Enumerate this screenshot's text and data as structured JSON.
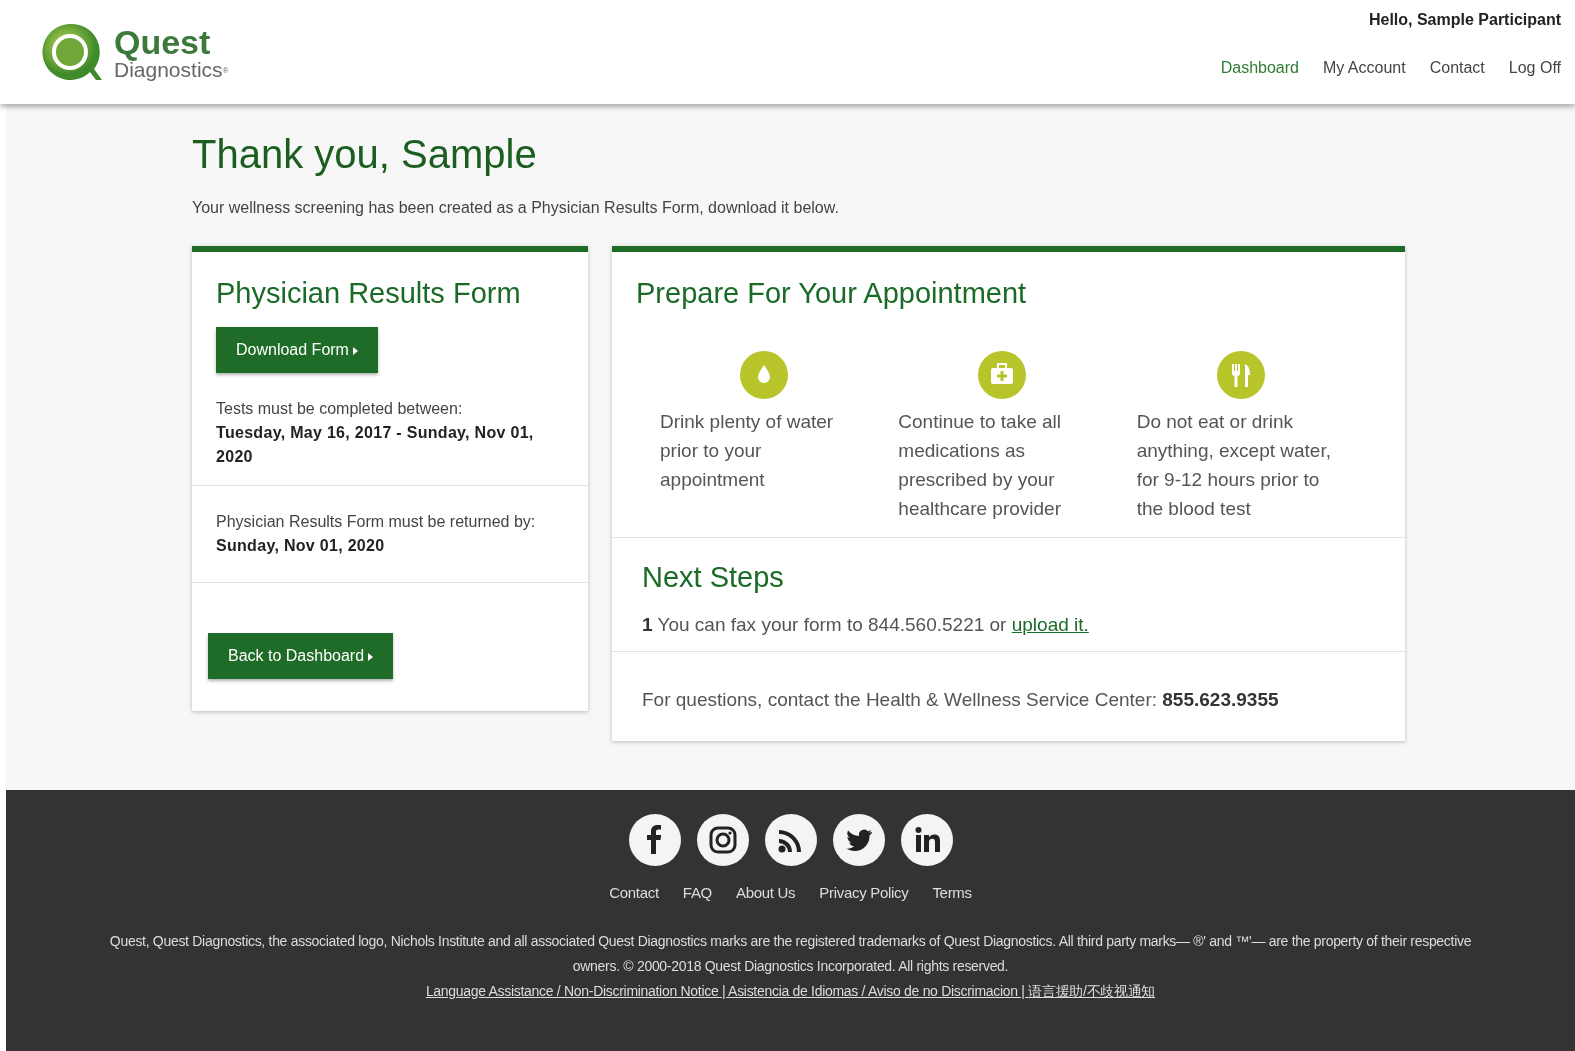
{
  "header": {
    "logo": {
      "line_1": "Quest",
      "line_2": "Diagnostics",
      "mark": "®"
    },
    "greeting": "Hello, Sample Participant",
    "nav": [
      {
        "label": "Dashboard",
        "selected": true
      },
      {
        "label": "My Account",
        "selected": false
      },
      {
        "label": "Contact",
        "selected": false
      },
      {
        "label": "Log Off",
        "selected": false
      }
    ]
  },
  "page": {
    "title": "Thank you, Sample",
    "intro": "Your wellness screening has been created as a Physician Results Form, download it below."
  },
  "form_card": {
    "title": "Physician Results Form",
    "download_button": "Download Form",
    "tests_label": "Tests must be completed between:",
    "tests_dates": "Tuesday, May 16, 2017 - Sunday, Nov 01, 2020",
    "return_label": "Physician Results Form must be returned by:",
    "return_date": "Sunday, Nov 01, 2020",
    "back_button": "Back to Dashboard"
  },
  "prepare_card": {
    "title": "Prepare For Your Appointment",
    "tips": [
      {
        "text": "Drink plenty of water prior to your appointment"
      },
      {
        "text": "Continue to take all medications as prescribed by your healthcare provider"
      },
      {
        "text": "Do not eat or drink anything, except water, for 9-12 hours prior to the blood test"
      }
    ],
    "next_steps_title": "Next Steps",
    "steps": [
      {
        "number": "1",
        "text": "You can fax your form to 844.560.5221 or",
        "link": "upload it."
      }
    ],
    "questions": "For questions, contact the Health & Wellness Service Center: **855.623.9355**"
  },
  "footer": {
    "links": [
      "Contact",
      "FAQ",
      "About Us",
      "Privacy Policy",
      "Terms"
    ],
    "legal": "Quest, Quest Diagnostics, the associated logo, Nichols Institute and all associated Quest Diagnostics marks are the registered trademarks of Quest Diagnostics. All third party marks— ®' and ™'— are the property of their respective owners. © 2000-2018 Quest Diagnostics Incorporated. All rights reserved.",
    "language_link": "Language Assistance / Non-Discrimination Notice | Asistencia de Idiomas / Aviso de no Discrimacion | 语言援助/不歧视通知"
  }
}
